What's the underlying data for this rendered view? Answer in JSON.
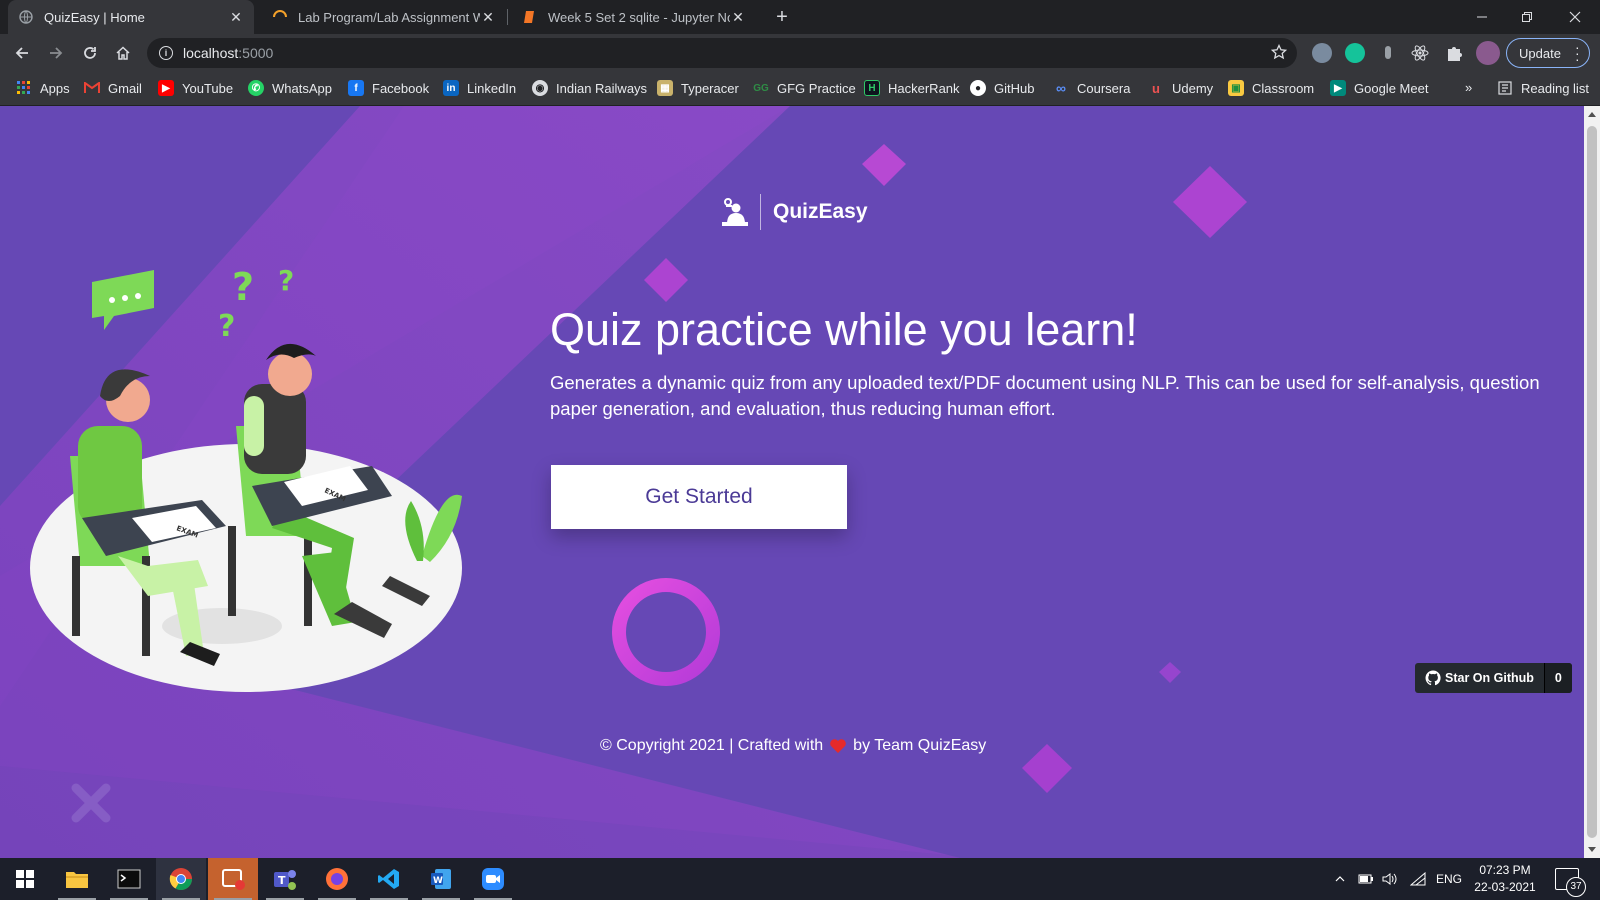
{
  "tabs": [
    {
      "title": "QuizEasy | Home",
      "icon": "globe-icon"
    },
    {
      "title": "Lab Program/Lab Assignment W",
      "icon": "loading-spinner-icon"
    },
    {
      "title": "Week 5 Set 2 sqlite - Jupyter Not",
      "icon": "jupyter-book-icon"
    }
  ],
  "address_bar": {
    "host": "localhost",
    "port": ":5000"
  },
  "update_button": "Update",
  "bookmarks": [
    {
      "label": "Apps",
      "icon": "apps-grid-icon"
    },
    {
      "label": "Gmail",
      "icon": "gmail-icon"
    },
    {
      "label": "YouTube",
      "icon": "youtube-icon"
    },
    {
      "label": "WhatsApp",
      "icon": "whatsapp-icon"
    },
    {
      "label": "Facebook",
      "icon": "facebook-icon"
    },
    {
      "label": "LinkedIn",
      "icon": "linkedin-icon"
    },
    {
      "label": "Indian Railways",
      "icon": "railways-icon"
    },
    {
      "label": "Typeracer",
      "icon": "typeracer-icon"
    },
    {
      "label": "GFG Practice",
      "icon": "gfg-icon"
    },
    {
      "label": "HackerRank",
      "icon": "hackerrank-icon"
    },
    {
      "label": "GitHub",
      "icon": "github-icon"
    },
    {
      "label": "Coursera",
      "icon": "coursera-icon"
    },
    {
      "label": "Udemy",
      "icon": "udemy-icon"
    },
    {
      "label": "Classroom",
      "icon": "classroom-icon"
    },
    {
      "label": "Google Meet",
      "icon": "google-meet-icon"
    }
  ],
  "overflow_chevron": "»",
  "reading_list": "Reading list",
  "page": {
    "brand": "QuizEasy",
    "title": "Quiz practice while you learn!",
    "description": "Generates a dynamic quiz from any uploaded text/PDF document using NLP. This can be used for self-analysis, question paper generation, and evaluation, thus reducing human effort.",
    "cta": "Get Started",
    "github_star_label": "Star On Github",
    "github_star_count": "0",
    "footer_before": "© Copyright 2021 | Crafted with",
    "footer_after": "by Team QuizEasy",
    "illustration_label": "EXAM"
  },
  "taskbar": {
    "apps": [
      "windows-start-icon",
      "file-explorer-icon",
      "terminal-icon",
      "chrome-icon",
      "snip-sketch-icon",
      "teams-icon",
      "firefox-icon",
      "vscode-icon",
      "word-icon",
      "zoom-icon"
    ],
    "language": "ENG",
    "time": "07:23 PM",
    "date": "22-03-2021",
    "notifications": "37"
  },
  "colors": {
    "page_bg": "#6648b5",
    "accent_purple": "#a14fd1",
    "cta_text": "#4b3a96",
    "illustration_green": "#7ed957"
  }
}
